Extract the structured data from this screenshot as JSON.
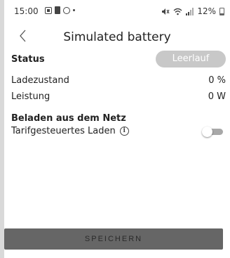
{
  "statusbar": {
    "time": "15:00",
    "battery_percent": "12%"
  },
  "header": {
    "back_icon": "chevron-left-icon",
    "title": "Simulated battery"
  },
  "status": {
    "label": "Status",
    "value": "Leerlauf"
  },
  "rows": [
    {
      "label": "Ladezustand",
      "value": "0 %"
    },
    {
      "label": "Leistung",
      "value": "0 W"
    }
  ],
  "grid_charging": {
    "heading": "Beladen aus dem Netz",
    "tariff_label": "Tarifgesteuertes Laden",
    "info_icon": "info-icon",
    "tariff_enabled": false
  },
  "actions": {
    "save_label": "SPEICHERN"
  },
  "colors": {
    "status_pill": "#c8c8c8",
    "save_button": "#666666",
    "toggle_track": "#a8a8a8"
  }
}
